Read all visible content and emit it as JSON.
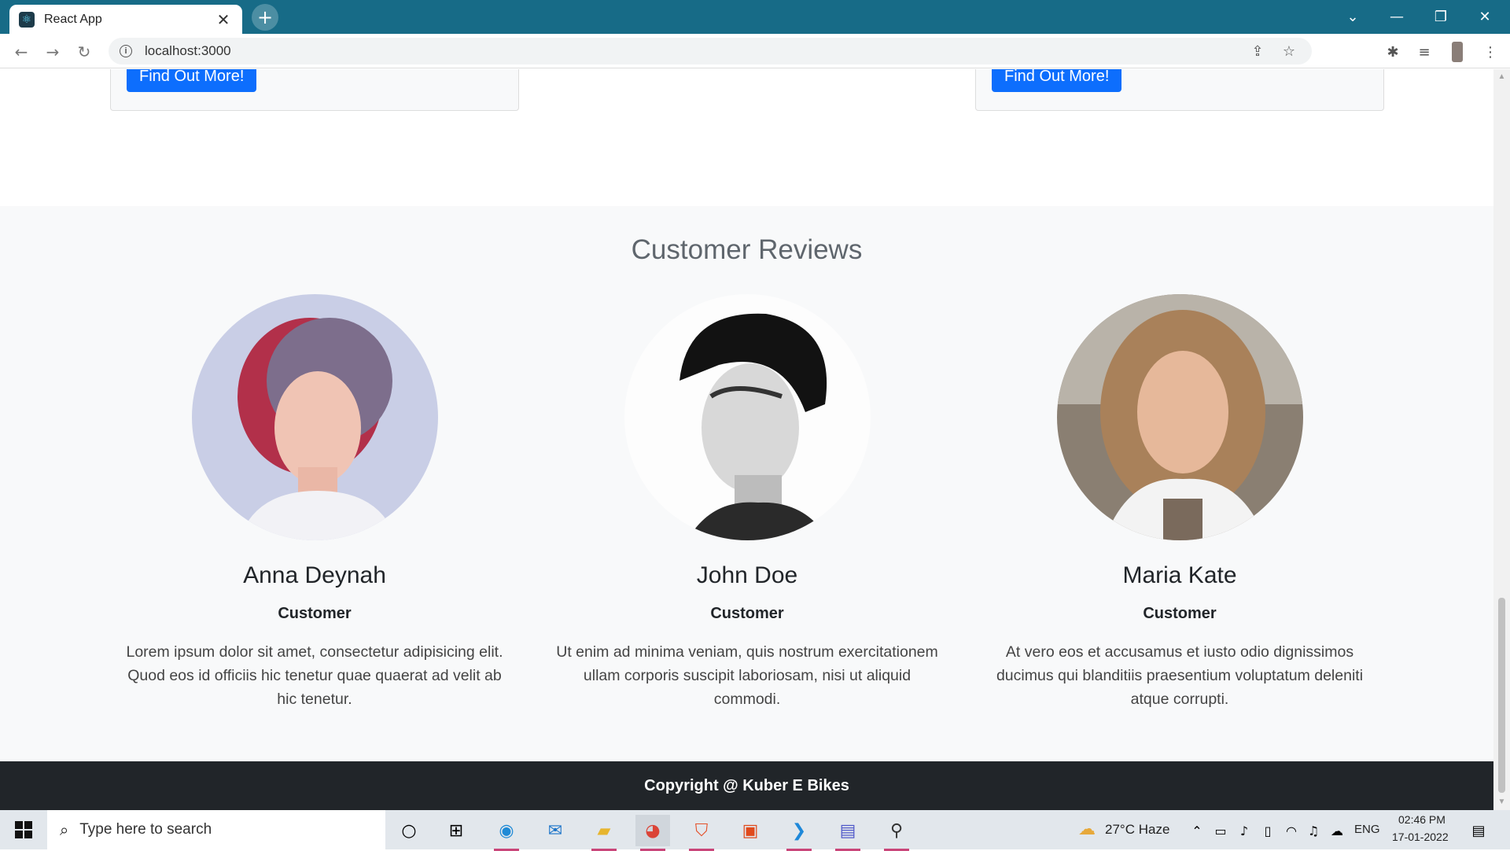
{
  "browser": {
    "tab_title": "React App",
    "tab_close": "✕",
    "new_tab": "+",
    "url": "localhost:3000",
    "window_controls": [
      "⌄",
      "—",
      "❐",
      "✕"
    ]
  },
  "page": {
    "cards": [
      {
        "button_label": "Find Out More!"
      },
      {
        "button_label": "Find Out More!"
      }
    ],
    "reviews_title": "Customer Reviews",
    "reviews": [
      {
        "name": "Anna Deynah",
        "role": "Customer",
        "text": "Lorem ipsum dolor sit amet, consectetur adipisicing elit. Quod eos id officiis hic tenetur quae quaerat ad velit ab hic tenetur."
      },
      {
        "name": "John Doe",
        "role": "Customer",
        "text": "Ut enim ad minima veniam, quis nostrum exercitationem ullam corporis suscipit laboriosam, nisi ut aliquid commodi."
      },
      {
        "name": "Maria Kate",
        "role": "Customer",
        "text": "At vero eos et accusamus et iusto odio dignissimos ducimus qui blanditiis praesentium voluptatum deleniti atque corrupti."
      }
    ],
    "footer": "Copyright @ Kuber E Bikes"
  },
  "taskbar": {
    "search_placeholder": "Type here to search",
    "weather": "27°C  Haze",
    "language": "ENG",
    "time": "02:46 PM",
    "date": "17-01-2022"
  },
  "colors": {
    "titlebar": "#176b87",
    "primary_button": "#0d6efd",
    "footer_bg": "#212529",
    "reviews_bg": "#f8f9fa"
  }
}
